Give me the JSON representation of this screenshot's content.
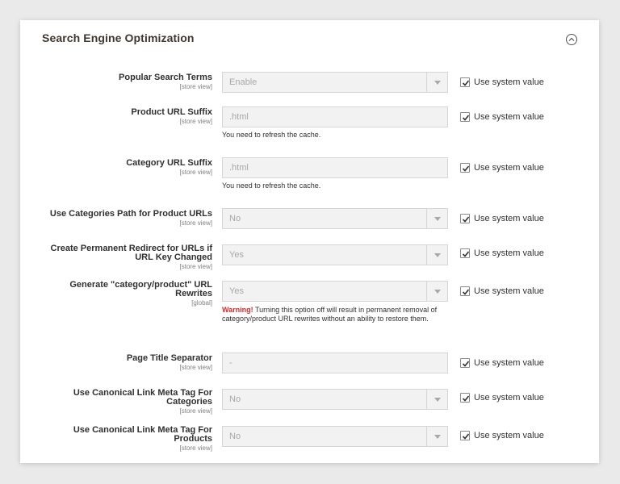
{
  "section": {
    "title": "Search Engine Optimization"
  },
  "system_value_label": "Use system value",
  "rows": [
    {
      "label": "Popular Search Terms",
      "scope": "[store view]",
      "value": "Enable",
      "type": "select"
    },
    {
      "label": "Product URL Suffix",
      "scope": "[store view]",
      "value": ".html",
      "type": "text",
      "note": "You need to refresh the cache."
    },
    {
      "label": "Category URL Suffix",
      "scope": "[store view]",
      "value": ".html",
      "type": "text",
      "note": "You need to refresh the cache."
    },
    {
      "label": "Use Categories Path for Product URLs",
      "scope": "[store view]",
      "value": "No",
      "type": "select"
    },
    {
      "label_line1": "Create Permanent Redirect for URLs if",
      "label_line2": "URL Key Changed",
      "scope": "[store view]",
      "value": "Yes",
      "type": "select"
    },
    {
      "label_line1": "Generate \"category/product\" URL",
      "label_line2": "Rewrites",
      "scope": "[global]",
      "value": "Yes",
      "type": "select",
      "warning_prefix": "Warning!",
      "warning_text": " Turning this option off will result in permanent removal of category/product URL rewrites without an ability to restore them."
    },
    {
      "label": "Page Title Separator",
      "scope": "[store view]",
      "value": "-",
      "type": "text"
    },
    {
      "label_line1": "Use Canonical Link Meta Tag For",
      "label_line2": "Categories",
      "scope": "[store view]",
      "value": "No",
      "type": "select"
    },
    {
      "label_line1": "Use Canonical Link Meta Tag For",
      "label_line2": "Products",
      "scope": "[store view]",
      "value": "No",
      "type": "select"
    }
  ]
}
